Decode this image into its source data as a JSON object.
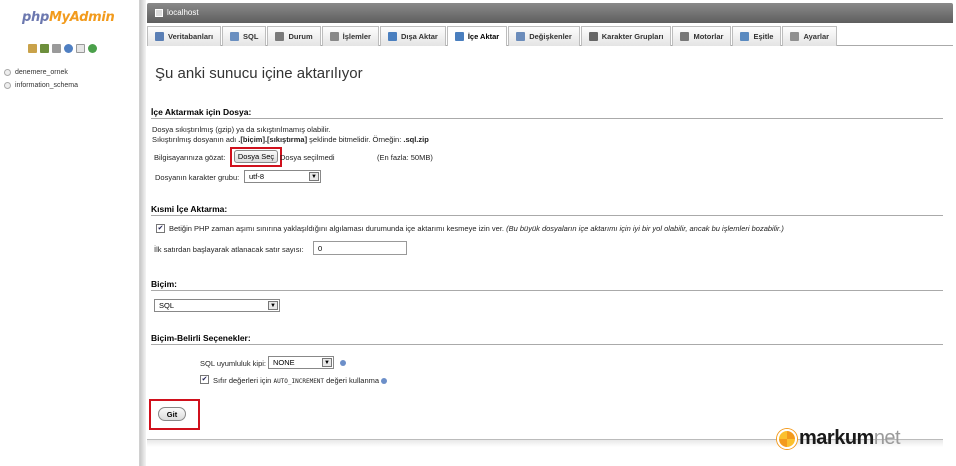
{
  "left": {
    "logo_part1": "php",
    "logo_part2": "MyAdmin",
    "icons": [
      "home-icon",
      "sql-window-icon",
      "query-icon",
      "docs-icon",
      "info-icon",
      "reload-icon"
    ],
    "databases": [
      "denemere_ornek",
      "information_schema"
    ]
  },
  "topbar": {
    "server": "localhost"
  },
  "tabs": [
    {
      "label": "Veritabanları",
      "icon": "database-icon",
      "color": "#5a7fb5"
    },
    {
      "label": "SQL",
      "icon": "sql-icon",
      "color": "#6a8fc0"
    },
    {
      "label": "Durum",
      "icon": "status-icon",
      "color": "#7a7a7a"
    },
    {
      "label": "İşlemler",
      "icon": "gear-icon",
      "color": "#888888"
    },
    {
      "label": "Dışa Aktar",
      "icon": "export-icon",
      "color": "#4a7fbf"
    },
    {
      "label": "İçe Aktar",
      "icon": "import-icon",
      "color": "#4a7fbf"
    },
    {
      "label": "Değişkenler",
      "icon": "variables-icon",
      "color": "#6b8cbb"
    },
    {
      "label": "Karakter Grupları",
      "icon": "charset-icon",
      "color": "#666666"
    },
    {
      "label": "Motorlar",
      "icon": "engine-icon",
      "color": "#777777"
    },
    {
      "label": "Eşitle",
      "icon": "sync-icon",
      "color": "#5a8ac0"
    },
    {
      "label": "Ayarlar",
      "icon": "wrench-icon",
      "color": "#8f8f8f"
    }
  ],
  "active_tab": "İçe Aktar",
  "main": {
    "heading": "Şu anki sunucu içine aktarılıyor",
    "file_section": {
      "title": "İçe Aktarmak için Dosya:",
      "line1": "Dosya sıkıştırılmış (gzip) ya da sıkıştırılmamış olabilir.",
      "line2_pre": "Sıkıştırılmış dosyanın adı ",
      "line2_bold": ".[biçim].[sıkıştırma]",
      "line2_post": " şeklinde bitmelidir. Örneğin: ",
      "line2_example": ".sql.zip",
      "browse_label": "Bilgisayarınıza gözat:",
      "choose_button": "Dosya Seç",
      "no_file": "Dosya seçilmedi",
      "max_size": "(En fazla: 50MB)",
      "charset_label": "Dosyanın karakter grubu:",
      "charset_value": "utf-8"
    },
    "partial_section": {
      "title": "Kısmi İçe Aktarma:",
      "checkbox_text": "Betiğin PHP zaman aşımı sınırına yaklaşıldığını algılaması durumunda içe aktarımı kesmeye izin ver.",
      "checkbox_note": "(Bu büyük dosyaların içe aktarımı için iyi bir yol olabilir, ancak bu işlemleri bozabilir.)",
      "skip_label": "İlk satırdan başlayarak atlanacak satır sayısı:",
      "skip_value": "0"
    },
    "format_section": {
      "title": "Biçim:",
      "format_value": "SQL"
    },
    "options_section": {
      "title": "Biçim-Belirli Seçenekler:",
      "compat_label": "SQL uyumluluk kipi:",
      "compat_value": "NONE",
      "auto_inc_pre": "Sıfır değerleri için ",
      "auto_inc_code": "AUTO_INCREMENT",
      "auto_inc_post": " değeri kullanma"
    },
    "go_button": "Git"
  },
  "brand": {
    "name": "markum",
    "suffix": "net"
  }
}
